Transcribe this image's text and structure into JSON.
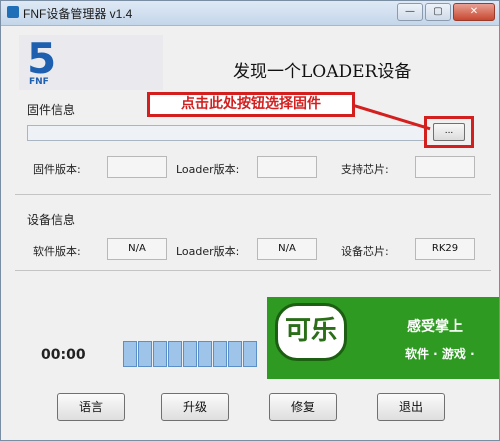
{
  "window": {
    "title": "FNF设备管理器 v1.4"
  },
  "window_controls": {
    "minimize": "—",
    "maximize": "▢",
    "close": "✕"
  },
  "logo": {
    "mark": "5",
    "sub": "FNF"
  },
  "header": {
    "status": "发现一个LOADER设备"
  },
  "firmware": {
    "section_label": "固件信息",
    "browse_label": "...",
    "fields": [
      {
        "label": "固件版本:",
        "value": ""
      },
      {
        "label": "Loader版本:",
        "value": ""
      },
      {
        "label": "支持芯片:",
        "value": ""
      }
    ]
  },
  "annotation": {
    "text": "点击此处按钮选择固件",
    "color": "#d41f1f"
  },
  "device": {
    "section_label": "设备信息",
    "fields": [
      {
        "label": "软件版本:",
        "value": "N/A"
      },
      {
        "label": "Loader版本:",
        "value": "N/A"
      },
      {
        "label": "设备芯片:",
        "value": "RK29"
      }
    ]
  },
  "progress": {
    "timer": "00:00"
  },
  "buttons": {
    "language": "语言",
    "upgrade": "升级",
    "repair": "修复",
    "exit": "退出"
  },
  "ad": {
    "logo_text": "可乐",
    "line1": "感受掌上",
    "line2": "软件 · 游戏 · "
  }
}
